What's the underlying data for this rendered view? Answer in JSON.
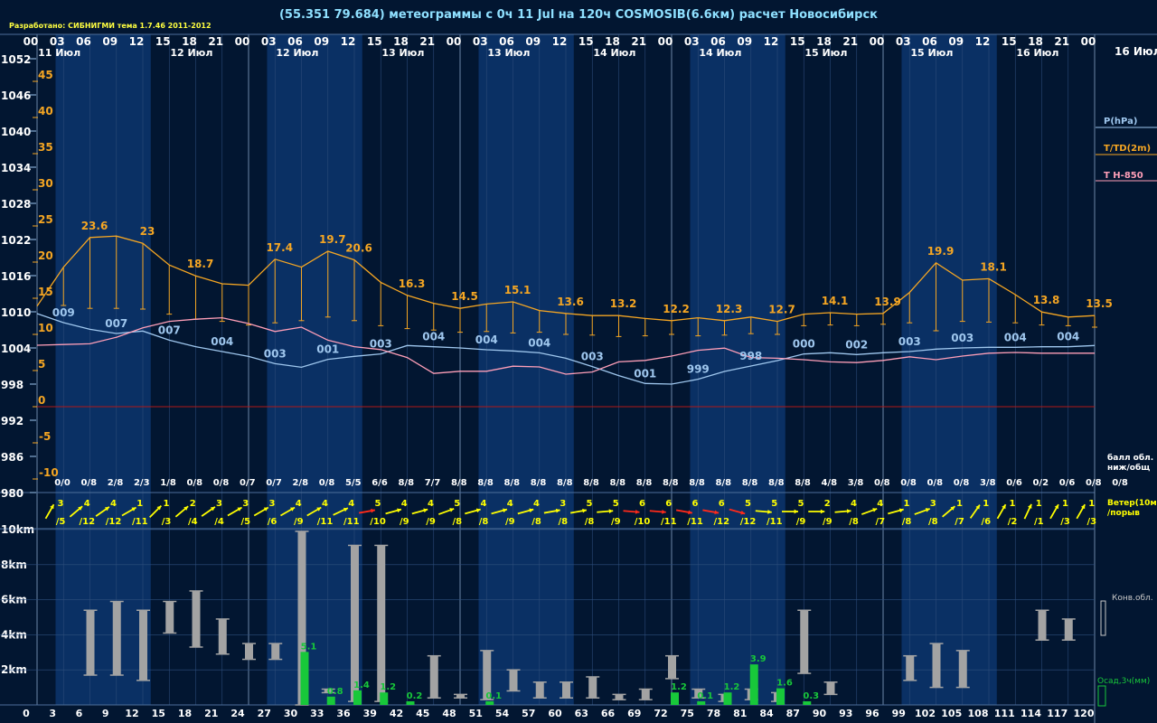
{
  "header": {
    "title": "(55.351 79.684) метеограммы с  0ч 11 Jul на 120ч COSMOSIB(6.6км) расчет Новосибирск",
    "credit": "Разработано: СИБНИГМИ тема 1.7.46 2011-2012"
  },
  "colors": {
    "background": "#021631",
    "daylight_band": "#0a3064",
    "pressure": "#9fc7ee",
    "temperature": "#f5a623",
    "t850": "#ff9fb8",
    "wind_normal": "#ffff00",
    "wind_strong": "#ff2a1a",
    "cloud_bar": "#a3a3a3",
    "precip": "#18c83a",
    "zero_line": "#b01818",
    "axis_text": "#ffffff",
    "hour_labels": "#ffffff",
    "cloud_text": "#ffffff",
    "wind_text": "#ffff00"
  },
  "top_hours": [
    "00",
    "03",
    "06",
    "09",
    "12",
    "15",
    "18",
    "21",
    "00",
    "03",
    "06",
    "09",
    "12",
    "15",
    "18",
    "21",
    "00",
    "03",
    "06",
    "09",
    "12",
    "15",
    "18",
    "21",
    "00",
    "03",
    "06",
    "09",
    "12",
    "15",
    "18",
    "21",
    "00",
    "03",
    "06",
    "09",
    "12",
    "15",
    "18",
    "21",
    "00"
  ],
  "date_labels": [
    {
      "text": "11 Июл",
      "pos": 0.5
    },
    {
      "text": "12 Июл",
      "pos": 5.5
    },
    {
      "text": "12 Июл",
      "pos": 9.5
    },
    {
      "text": "13 Июл",
      "pos": 13.5
    },
    {
      "text": "13 Июл",
      "pos": 17.5
    },
    {
      "text": "14 Июл",
      "pos": 21.5
    },
    {
      "text": "14 Июл",
      "pos": 25.5
    },
    {
      "text": "15 Июл",
      "pos": 29.5
    },
    {
      "text": "15 Июл",
      "pos": 33.5
    },
    {
      "text": "16 Июл",
      "pos": 37.5
    }
  ],
  "right_date": "16 Июл",
  "legend": {
    "pressure": "P(hPa)",
    "temperature": "T/TD(2m)",
    "t850": "T H-850",
    "cloud_cover": [
      "балл обл.",
      "ниж/общ"
    ],
    "wind": [
      "Ветер(10м)",
      "/порыв"
    ],
    "convective": "Конв.обл.",
    "precip": "Осад,3ч(мм)"
  },
  "chart_data": {
    "type": "line",
    "daylight_bands": [
      [
        0.7,
        4.3
      ],
      [
        8.7,
        12.3
      ],
      [
        16.7,
        20.3
      ],
      [
        24.7,
        28.3
      ],
      [
        32.7,
        36.3
      ]
    ],
    "pressure_axis": {
      "ylim": [
        980,
        1052
      ],
      "ticks": [
        1052,
        1046,
        1040,
        1034,
        1028,
        1022,
        1016,
        1010,
        1004,
        998,
        992,
        986,
        980
      ]
    },
    "temperature_axis": {
      "ylim": [
        -10,
        45
      ],
      "ticks": [
        45,
        40,
        35,
        30,
        25,
        20,
        15,
        10,
        5,
        0,
        -5,
        -10
      ]
    },
    "series": [
      {
        "name": "P(hPa)",
        "values": [
          1009.7,
          1008.2,
          1007.1,
          1006.4,
          1006.8,
          1005.3,
          1004.2,
          1003.4,
          1002.6,
          1001.4,
          1000.8,
          1002.1,
          1002.6,
          1003.0,
          1004.4,
          1004.2,
          1004.0,
          1003.7,
          1003.5,
          1003.2,
          1002.3,
          1000.9,
          999.4,
          998.1,
          998.0,
          998.8,
          1000.1,
          1001.0,
          1001.9,
          1003.0,
          1003.2,
          1002.9,
          1003.2,
          1003.4,
          1003.8,
          1004.0,
          1004.1,
          1004.1,
          1004.2,
          1004.2,
          1004.4
        ],
        "labels": [
          {
            "i": 1,
            "t": "009"
          },
          {
            "i": 3,
            "t": "007"
          },
          {
            "i": 5,
            "t": "007"
          },
          {
            "i": 7,
            "t": "004"
          },
          {
            "i": 9,
            "t": "003"
          },
          {
            "i": 11,
            "t": "001"
          },
          {
            "i": 13,
            "t": "003"
          },
          {
            "i": 15,
            "t": "004"
          },
          {
            "i": 17,
            "t": "004"
          },
          {
            "i": 19,
            "t": "004"
          },
          {
            "i": 21,
            "t": "003"
          },
          {
            "i": 23,
            "t": "001"
          },
          {
            "i": 25,
            "t": "999"
          },
          {
            "i": 27,
            "t": "998"
          },
          {
            "i": 29,
            "t": "000"
          },
          {
            "i": 31,
            "t": "002"
          },
          {
            "i": 33,
            "t": "003"
          },
          {
            "i": 35,
            "t": "003"
          },
          {
            "i": 37,
            "t": "004"
          },
          {
            "i": 39,
            "t": "004"
          }
        ]
      },
      {
        "name": "T/TD(2m)",
        "values": [
          13.9,
          19.3,
          23.4,
          23.6,
          22.6,
          19.6,
          18.1,
          17.0,
          16.8,
          20.4,
          19.3,
          21.5,
          20.3,
          17.2,
          15.4,
          14.3,
          13.6,
          14.2,
          14.5,
          13.3,
          12.9,
          12.6,
          12.6,
          12.2,
          11.9,
          12.3,
          11.9,
          12.4,
          11.8,
          12.8,
          13.0,
          12.8,
          12.9,
          15.8,
          19.9,
          17.5,
          17.7,
          15.5,
          13.1,
          12.4,
          12.6
        ],
        "labels": [
          {
            "i": 2,
            "t": "23.6"
          },
          {
            "i": 4,
            "t": "23"
          },
          {
            "i": 6,
            "t": "18.7"
          },
          {
            "i": 9,
            "t": "17.4"
          },
          {
            "i": 11,
            "t": "19.7"
          },
          {
            "i": 12,
            "t": "20.6"
          },
          {
            "i": 14,
            "t": "16.3"
          },
          {
            "i": 16,
            "t": "14.5"
          },
          {
            "i": 18,
            "t": "15.1"
          },
          {
            "i": 20,
            "t": "13.6"
          },
          {
            "i": 22,
            "t": "13.2"
          },
          {
            "i": 24,
            "t": "12.2"
          },
          {
            "i": 26,
            "t": "12.3"
          },
          {
            "i": 28,
            "t": "12.7"
          },
          {
            "i": 30,
            "t": "14.1"
          },
          {
            "i": 32,
            "t": "13.9"
          },
          {
            "i": 34,
            "t": "19.9"
          },
          {
            "i": 36,
            "t": "18.1"
          },
          {
            "i": 38,
            "t": "13.8"
          },
          {
            "i": 40,
            "t": "13.5"
          }
        ]
      },
      {
        "name": "TD(2m)",
        "values": [
          13.9,
          14.0,
          13.6,
          13.6,
          13.5,
          12.8,
          12.1,
          11.8,
          11.3,
          11.6,
          11.9,
          12.4,
          11.9,
          11.2,
          10.8,
          10.6,
          10.3,
          10.4,
          10.2,
          10.3,
          10.0,
          9.9,
          9.7,
          9.8,
          10.0,
          9.8,
          9.9,
          10.1,
          10.0,
          11.2,
          11.3,
          11.2,
          11.4,
          11.6,
          10.5,
          11.8,
          11.7,
          11.6,
          11.3,
          11.2,
          11.0
        ]
      },
      {
        "name": "T H-850",
        "values": [
          8.5,
          8.6,
          8.7,
          9.6,
          10.9,
          11.8,
          12.1,
          12.3,
          11.5,
          10.4,
          11.0,
          9.2,
          8.3,
          7.9,
          6.8,
          4.6,
          4.9,
          4.9,
          5.6,
          5.5,
          4.5,
          4.8,
          6.2,
          6.4,
          7.0,
          7.8,
          8.1,
          6.8,
          6.7,
          6.5,
          6.2,
          6.1,
          6.4,
          6.9,
          6.5,
          7.0,
          7.4,
          7.5,
          7.4,
          7.4,
          7.4
        ]
      }
    ],
    "cloud_cover": [
      "0/0",
      "0/8",
      "2/8",
      "2/3",
      "1/8",
      "0/8",
      "0/8",
      "0/7",
      "0/7",
      "2/8",
      "0/8",
      "5/5",
      "6/6",
      "8/8",
      "7/7",
      "8/8",
      "8/8",
      "8/8",
      "8/8",
      "8/8",
      "8/8",
      "8/8",
      "8/8",
      "8/8",
      "8/8",
      "8/8",
      "8/8",
      "8/8",
      "8/8",
      "4/8",
      "3/8",
      "0/8",
      "0/8",
      "0/8",
      "0/8",
      "3/8",
      "0/6",
      "0/2",
      "0/6",
      "0/8",
      "0/8"
    ],
    "wind": {
      "speed": [
        3,
        4,
        4,
        1,
        1,
        2,
        3,
        3,
        3,
        4,
        4,
        4,
        5,
        4,
        4,
        5,
        4,
        4,
        4,
        3,
        5,
        5,
        6,
        6,
        6,
        6,
        5,
        5,
        5,
        2,
        4,
        4,
        1,
        3,
        1,
        1,
        1,
        1,
        1,
        1
      ],
      "gust": [
        5,
        12,
        12,
        11,
        3,
        4,
        4,
        5,
        6,
        9,
        11,
        11,
        10,
        9,
        9,
        8,
        8,
        9,
        8,
        8,
        8,
        9,
        10,
        11,
        11,
        12,
        12,
        11,
        9,
        9,
        8,
        7,
        8,
        8,
        7,
        6,
        2,
        1,
        3,
        3
      ],
      "dir_deg": [
        30,
        50,
        55,
        60,
        45,
        50,
        55,
        60,
        60,
        60,
        60,
        65,
        80,
        75,
        75,
        70,
        75,
        75,
        75,
        80,
        80,
        85,
        95,
        95,
        100,
        100,
        105,
        95,
        90,
        90,
        85,
        70,
        75,
        70,
        50,
        35,
        30,
        25,
        30,
        30
      ],
      "strong": [
        false,
        false,
        false,
        false,
        false,
        false,
        false,
        false,
        false,
        false,
        false,
        false,
        true,
        false,
        false,
        false,
        false,
        false,
        false,
        false,
        false,
        false,
        true,
        true,
        true,
        true,
        true,
        false,
        false,
        false,
        false,
        false,
        false,
        false,
        false,
        false,
        false,
        false,
        false,
        false
      ]
    },
    "height_axis": {
      "ylim": [
        0,
        10
      ],
      "ticks": [
        {
          "v": 10,
          "t": "10km"
        },
        {
          "v": 8,
          "t": "8km"
        },
        {
          "v": 6,
          "t": "6km"
        },
        {
          "v": 4,
          "t": "4km"
        },
        {
          "v": 2,
          "t": "2km"
        }
      ]
    },
    "bottom_hours": [
      "0",
      "3",
      "6",
      "9",
      "12",
      "15",
      "18",
      "21",
      "24",
      "27",
      "30",
      "33",
      "36",
      "39",
      "42",
      "45",
      "48",
      "51",
      "54",
      "57",
      "60",
      "63",
      "66",
      "69",
      "72",
      "75",
      "78",
      "81",
      "84",
      "87",
      "90",
      "93",
      "96",
      "99",
      "102",
      "105",
      "108",
      "111",
      "114",
      "117",
      "120"
    ],
    "convective_clouds": [
      {
        "i": 2,
        "bot": 1.7,
        "top": 5.4
      },
      {
        "i": 3,
        "bot": 1.7,
        "top": 5.9
      },
      {
        "i": 4,
        "bot": 1.4,
        "top": 5.4
      },
      {
        "i": 5,
        "bot": 4.1,
        "top": 5.9
      },
      {
        "i": 6,
        "bot": 3.3,
        "top": 6.5
      },
      {
        "i": 7,
        "bot": 2.9,
        "top": 4.9
      },
      {
        "i": 8,
        "bot": 2.6,
        "top": 3.5
      },
      {
        "i": 9,
        "bot": 2.6,
        "top": 3.5
      },
      {
        "i": 10,
        "bot": 0.0,
        "top": 9.9
      },
      {
        "i": 11,
        "bot": 0.7,
        "top": 0.9
      },
      {
        "i": 12,
        "bot": 0.2,
        "top": 9.1
      },
      {
        "i": 13,
        "bot": 0.2,
        "top": 9.1
      },
      {
        "i": 15,
        "bot": 0.4,
        "top": 2.8
      },
      {
        "i": 16,
        "bot": 0.4,
        "top": 0.6
      },
      {
        "i": 17,
        "bot": 0.3,
        "top": 3.1
      },
      {
        "i": 18,
        "bot": 0.8,
        "top": 2.0
      },
      {
        "i": 19,
        "bot": 0.4,
        "top": 1.3
      },
      {
        "i": 20,
        "bot": 0.4,
        "top": 1.3
      },
      {
        "i": 21,
        "bot": 0.4,
        "top": 1.6
      },
      {
        "i": 22,
        "bot": 0.3,
        "top": 0.6
      },
      {
        "i": 23,
        "bot": 0.3,
        "top": 0.9
      },
      {
        "i": 24,
        "bot": 1.5,
        "top": 2.8
      },
      {
        "i": 25,
        "bot": 0.4,
        "top": 0.9
      },
      {
        "i": 26,
        "bot": 0.2,
        "top": 0.6
      },
      {
        "i": 27,
        "bot": 0.3,
        "top": 0.9
      },
      {
        "i": 28,
        "bot": 0.2,
        "top": 0.7
      },
      {
        "i": 29,
        "bot": 1.8,
        "top": 5.4
      },
      {
        "i": 30,
        "bot": 0.6,
        "top": 1.3
      },
      {
        "i": 33,
        "bot": 1.4,
        "top": 2.8
      },
      {
        "i": 34,
        "bot": 1.0,
        "top": 3.5
      },
      {
        "i": 35,
        "bot": 1.0,
        "top": 3.1
      },
      {
        "i": 38,
        "bot": 3.7,
        "top": 5.4
      },
      {
        "i": 39,
        "bot": 3.7,
        "top": 4.9
      }
    ],
    "precipitation": [
      {
        "i": 10,
        "v": 5.1,
        "t": "5.1"
      },
      {
        "i": 11,
        "v": 0.8,
        "t": "0.8"
      },
      {
        "i": 12,
        "v": 1.4,
        "t": "1.4"
      },
      {
        "i": 13,
        "v": 1.2,
        "t": "1.2"
      },
      {
        "i": 14,
        "v": 0.2,
        "t": "0.2"
      },
      {
        "i": 17,
        "v": 0.1,
        "t": "0.1"
      },
      {
        "i": 24,
        "v": 1.2,
        "t": "1.2"
      },
      {
        "i": 25,
        "v": 0.1,
        "t": "0.1"
      },
      {
        "i": 26,
        "v": 1.2,
        "t": "1.2"
      },
      {
        "i": 27,
        "v": 3.9,
        "t": "3.9"
      },
      {
        "i": 28,
        "v": 1.6,
        "t": "1.6"
      },
      {
        "i": 29,
        "v": 0.3,
        "t": "0.3"
      }
    ]
  }
}
